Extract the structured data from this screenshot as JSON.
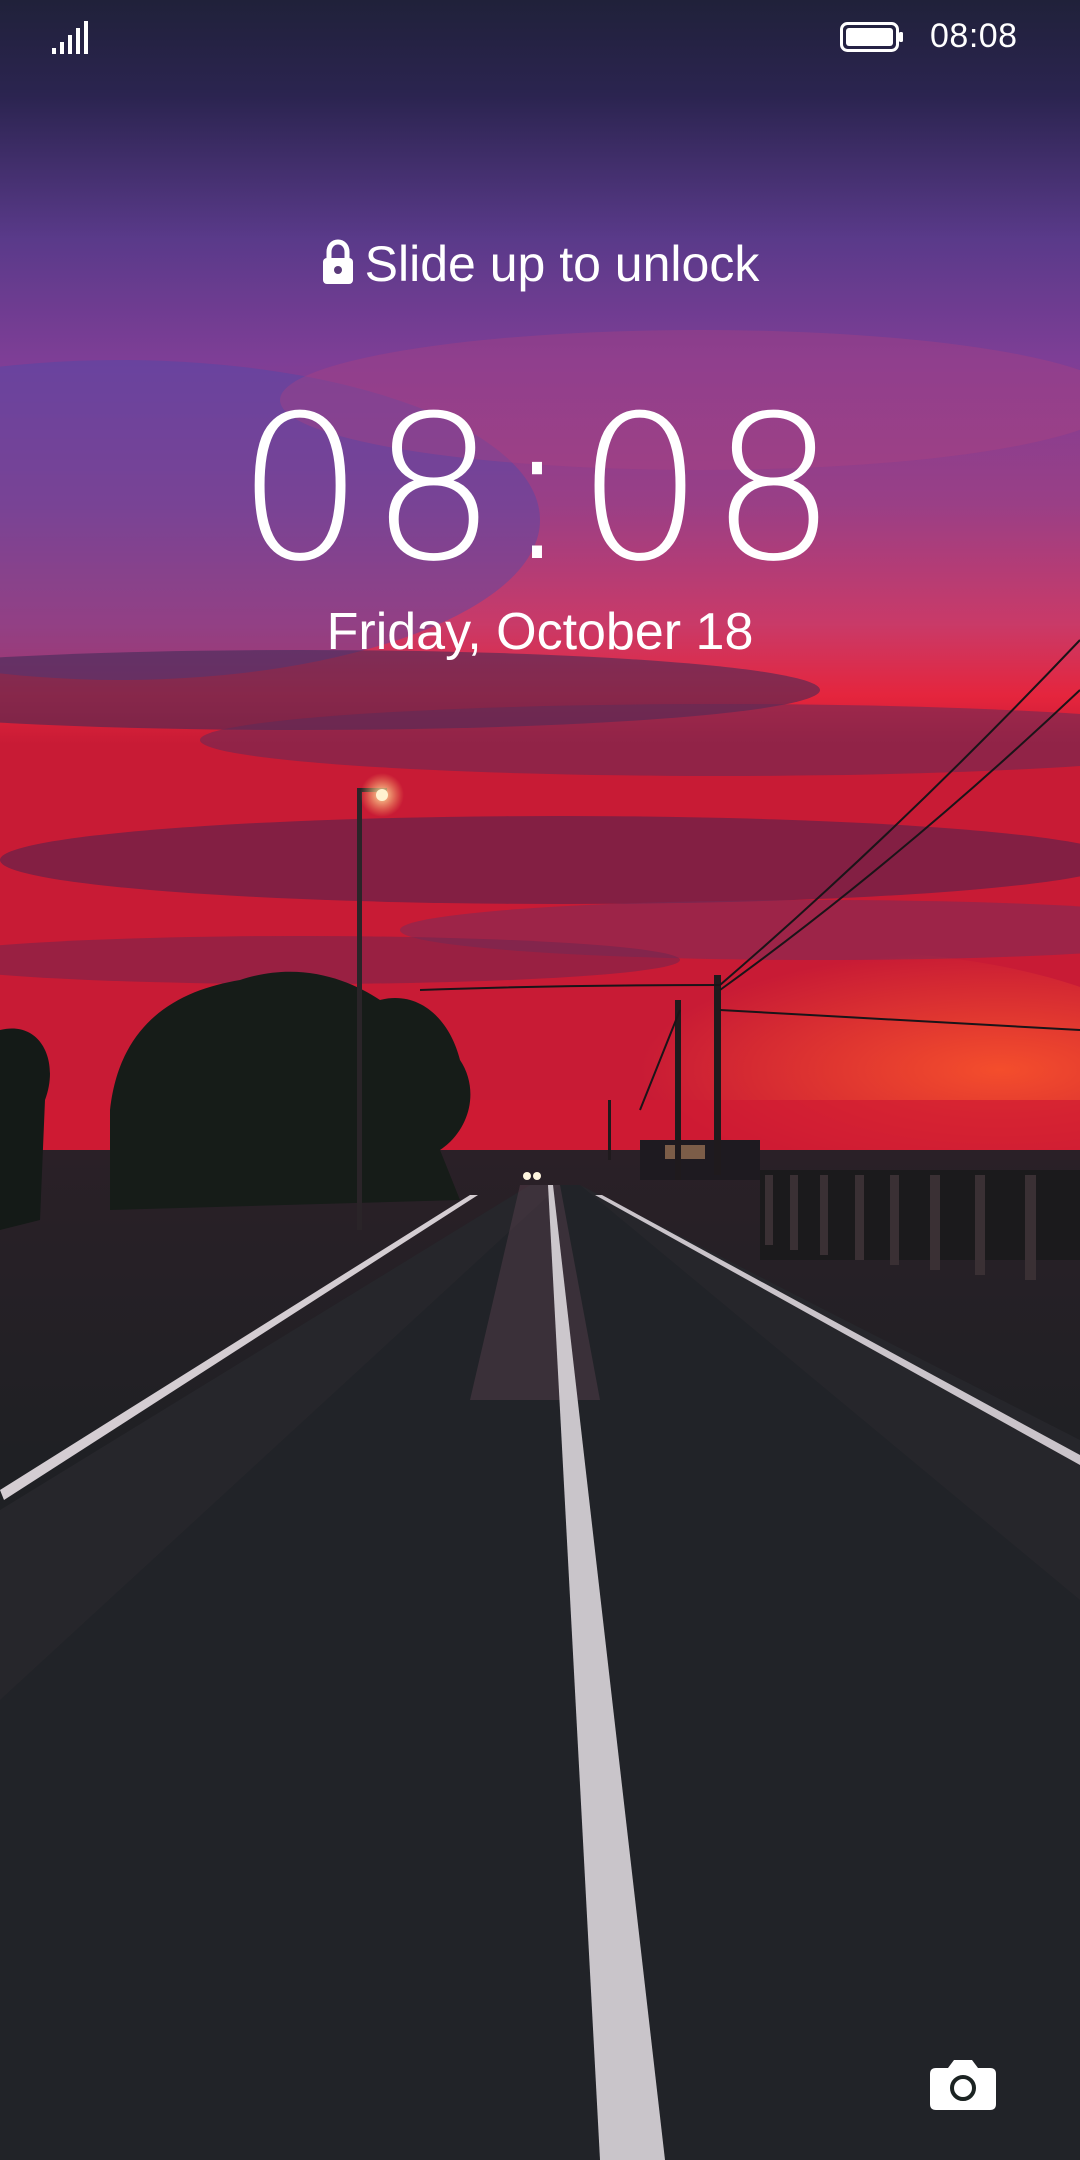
{
  "status_bar": {
    "time": "08:08",
    "signal_icon": "cellular-signal-icon",
    "battery_icon": "battery-full-icon"
  },
  "lock_screen": {
    "unlock_hint": "Slide up to unlock",
    "lock_icon": "padlock-icon",
    "clock": "08:08",
    "date": "Friday, October 18",
    "camera_icon": "camera-icon"
  },
  "colors": {
    "text": "#ffffff",
    "sky_top": "#2a2347",
    "sky_mid": "#7b3a8e",
    "sunset": "#e8203a",
    "road": "#1b2322"
  }
}
